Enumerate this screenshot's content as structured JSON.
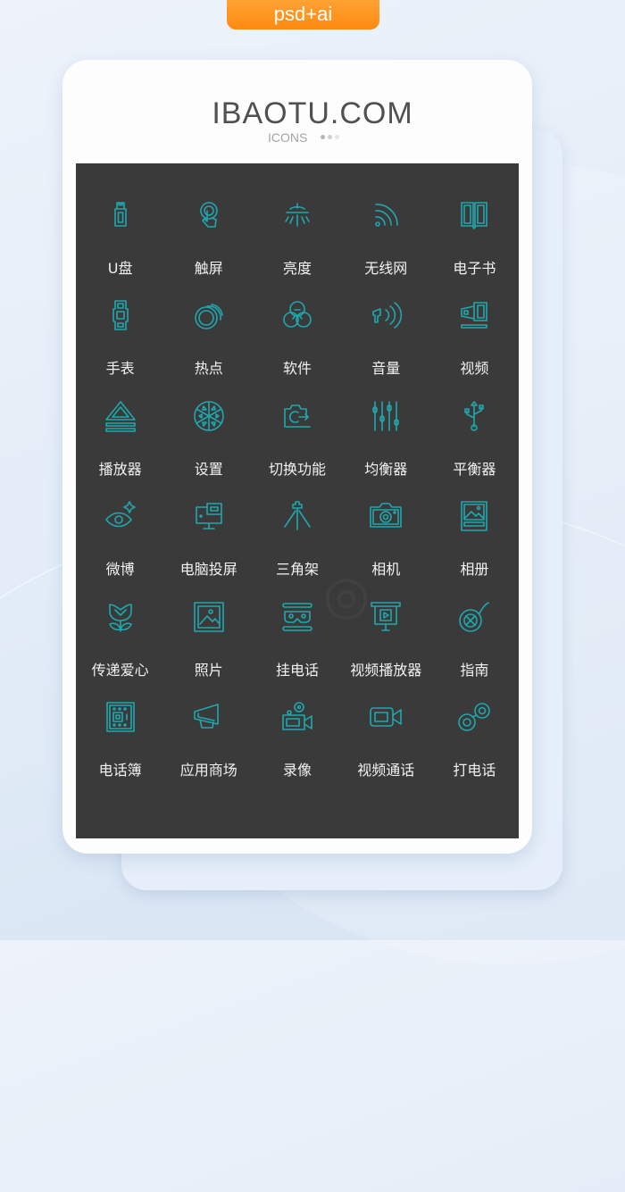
{
  "badge": {
    "label": "psd+ai",
    "color": "#ff9222"
  },
  "header": {
    "brand": "IBAOTU.COM",
    "subtitle": "ICONS",
    "dot_colors": [
      "#b5b5b5",
      "#cfcfcf",
      "#e3e3e3"
    ]
  },
  "panel": {
    "background": "#3a3a3a",
    "icon_color": "#1fa8ad"
  },
  "icons": [
    {
      "name": "usb-drive-icon",
      "label": "U盘"
    },
    {
      "name": "touchscreen-icon",
      "label": "触屏"
    },
    {
      "name": "brightness-icon",
      "label": "亮度"
    },
    {
      "name": "wifi-icon",
      "label": "无线网"
    },
    {
      "name": "ebook-icon",
      "label": "电子书"
    },
    {
      "name": "watch-icon",
      "label": "手表"
    },
    {
      "name": "hotspot-icon",
      "label": "热点"
    },
    {
      "name": "software-icon",
      "label": "软件"
    },
    {
      "name": "volume-icon",
      "label": "音量"
    },
    {
      "name": "video-icon",
      "label": "视频"
    },
    {
      "name": "eject-player-icon",
      "label": "播放器"
    },
    {
      "name": "settings-icon",
      "label": "设置"
    },
    {
      "name": "switch-function-icon",
      "label": "切换功能"
    },
    {
      "name": "equalizer-icon",
      "label": "均衡器"
    },
    {
      "name": "balancer-icon",
      "label": "平衡器"
    },
    {
      "name": "weibo-eye-icon",
      "label": "微博"
    },
    {
      "name": "screen-cast-icon",
      "label": "电脑投屏"
    },
    {
      "name": "tripod-icon",
      "label": "三角架"
    },
    {
      "name": "camera-icon",
      "label": "相机"
    },
    {
      "name": "album-icon",
      "label": "相册"
    },
    {
      "name": "love-flower-icon",
      "label": "传递爱心"
    },
    {
      "name": "photo-icon",
      "label": "照片"
    },
    {
      "name": "hang-up-icon",
      "label": "挂电话"
    },
    {
      "name": "video-player-icon",
      "label": "视频播放器"
    },
    {
      "name": "guide-icon",
      "label": "指南"
    },
    {
      "name": "phonebook-icon",
      "label": "电话簿"
    },
    {
      "name": "app-store-megaphone-icon",
      "label": "应用商场"
    },
    {
      "name": "recorder-icon",
      "label": "录像"
    },
    {
      "name": "video-call-icon",
      "label": "视频通话"
    },
    {
      "name": "call-icon",
      "label": "打电话"
    }
  ]
}
